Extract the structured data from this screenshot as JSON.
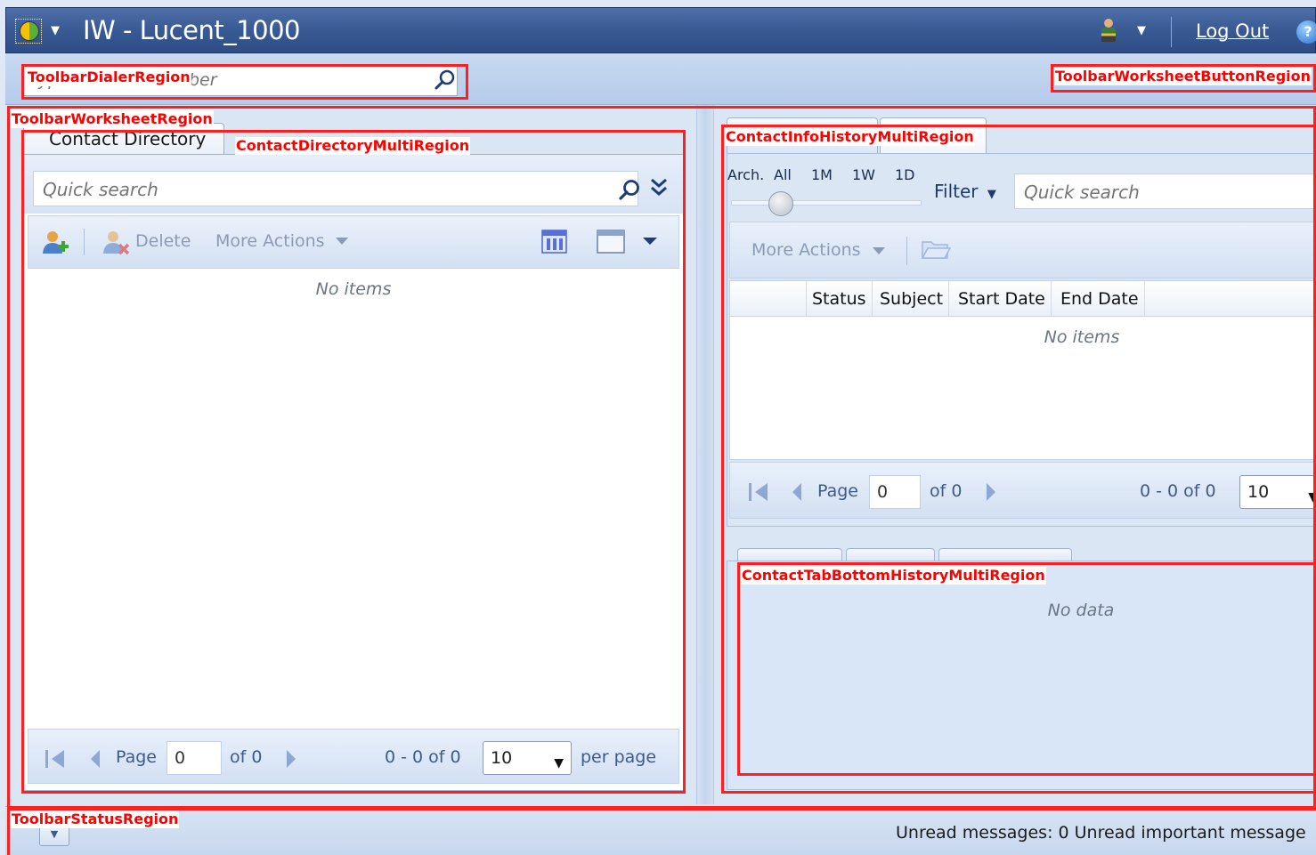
{
  "window": {
    "title": "IW - Lucent_1000",
    "logout_label": "Log Out",
    "help_icon": "?",
    "menu_arrow": "▼",
    "user_menu_arrow": "▼"
  },
  "dialer": {
    "placeholder": "Type name or number",
    "search_icon": "search-icon"
  },
  "contact_directory": {
    "tab_label": "Contact Directory",
    "search_placeholder": "Quick search",
    "toolbar": {
      "delete_label": "Delete",
      "more_actions_label": "More Actions"
    },
    "empty_text": "No items",
    "pager": {
      "page_label": "Page",
      "page_value": "0",
      "of_label": "of 0",
      "range_label": "0 - 0 of 0",
      "page_size": "10",
      "per_page_label": "per page"
    }
  },
  "contact_history": {
    "timeline": {
      "arch_label": "Arch.",
      "all_label": "All",
      "month_label": "1M",
      "week_label": "1W",
      "day_label": "1D"
    },
    "filter_label": "Filter",
    "search_placeholder": "Quick search",
    "more_actions_label": "More Actions",
    "columns": [
      "Status",
      "Subject",
      "Start Date",
      "End Date"
    ],
    "empty_text": "No items",
    "pager": {
      "page_label": "Page",
      "page_value": "0",
      "of_label": "of 0",
      "range_label": "0 - 0 of 0",
      "page_size": "10"
    }
  },
  "bottom_history": {
    "empty_text": "No data"
  },
  "status_bar": {
    "text": "Unread messages: 0 Unread important message"
  },
  "regions": {
    "toolbar_dialer": "ToolbarDialerRegion",
    "toolbar_worksheet_button": "ToolbarWorksheetButtonRegion",
    "toolbar_worksheet": "ToolbarWorksheetRegion",
    "contact_directory_multi": "ContactDirectoryMultiRegion",
    "contact_info_history_multi": "ContactInfoHistoryMultiRegion",
    "contact_tab_bottom_history_multi": "ContactTabBottomHistoryMultiRegion",
    "toolbar_status": "ToolbarStatusRegion"
  },
  "colors": {
    "region_outline": "#ff1f1f",
    "title_bar": "#3a5b95",
    "panel_background": "#dbe6f4"
  }
}
